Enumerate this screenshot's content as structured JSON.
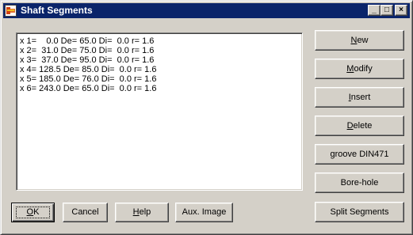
{
  "window": {
    "title": "Shaft Segments",
    "icon": "app-icon",
    "controls": {
      "minimize": "_",
      "maximize": "□",
      "close": "×"
    }
  },
  "segments": [
    "x 1=    0.0 De= 65.0 Di=  0.0 r= 1.6",
    "x 2=  31.0 De= 75.0 Di=  0.0 r= 1.6",
    "x 3=  37.0 De= 95.0 Di=  0.0 r= 1.6",
    "x 4= 128.5 De= 85.0 Di=  0.0 r= 1.6",
    "x 5= 185.0 De= 76.0 Di=  0.0 r= 1.6",
    "x 6= 243.0 De= 65.0 Di=  0.0 r= 1.6"
  ],
  "actions": {
    "new": {
      "mnemonic": "N",
      "rest": "ew"
    },
    "modify": {
      "mnemonic": "M",
      "rest": "odify"
    },
    "insert": {
      "mnemonic": "I",
      "rest": "nsert"
    },
    "delete": {
      "mnemonic": "D",
      "rest": "elete"
    },
    "groove": "groove DIN471",
    "borehole": "Bore-hole",
    "split": "Split Segments"
  },
  "footer": {
    "ok": {
      "mnemonic": "O",
      "rest": "K"
    },
    "cancel": "Cancel",
    "help": {
      "mnemonic": "H",
      "rest": "elp"
    },
    "aux_image": "Aux. Image"
  }
}
